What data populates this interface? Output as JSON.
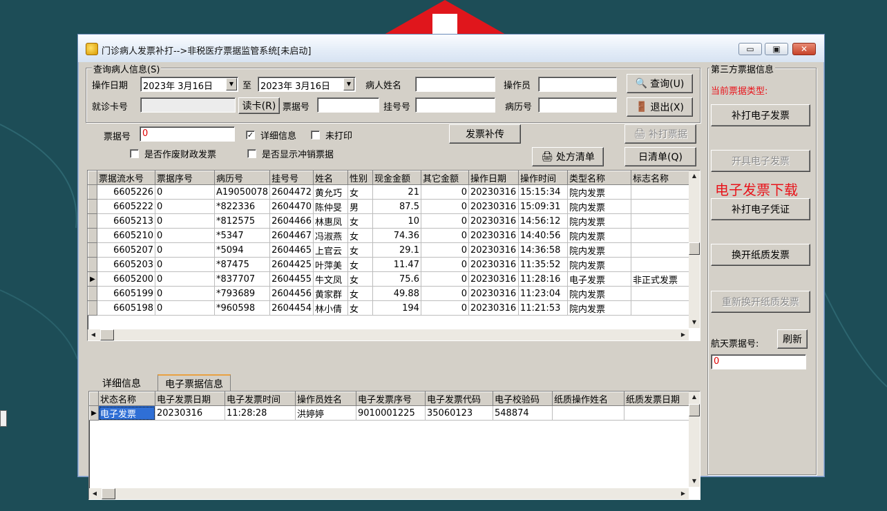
{
  "window": {
    "title": "门诊病人发票补打-->非税医疗票据监管系统[未启动]",
    "min_glyph": "▭",
    "max_glyph": "▣",
    "close_glyph": "✕"
  },
  "query": {
    "group_title": "查询病人信息(S)",
    "op_date_label": "操作日期",
    "date_from": "2023年 3月16日",
    "to_label": "至",
    "date_to": "2023年 3月16日",
    "patient_name_label": "病人姓名",
    "patient_name": "",
    "operator_label": "操作员",
    "operator": "",
    "search_button": "查询(U)",
    "card_label": "就诊卡号",
    "card_no": "",
    "read_card_button": "读卡(R)",
    "bill_label": "票据号",
    "bill_no": "",
    "reg_label": "挂号号",
    "reg_no": "",
    "record_label": "病历号",
    "record_no": "",
    "exit_button": "退出(X)"
  },
  "filters": {
    "bill_no_label": "票据号",
    "bill_no_value": "0",
    "detail_info": "详细信息",
    "detail_info_checked": true,
    "unprinted": "未打印",
    "unprinted_checked": false,
    "voided": "是否作废财政发票",
    "show_reversed": "是否显示冲销票据",
    "invoice_upload_button": "发票补传",
    "reprint_button": "补打票据",
    "prescription_button": "处方清单",
    "daily_button": "日清单(Q)"
  },
  "main_table": {
    "columns": [
      "票据流水号",
      "票据序号",
      "病历号",
      "挂号号",
      "姓名",
      "性别",
      "现金金额",
      "其它金额",
      "操作日期",
      "操作时间",
      "类型名称",
      "标志名称"
    ],
    "rows": [
      [
        "6605226",
        "0",
        "A19050078",
        "2604472",
        "黄允巧",
        "女",
        "21",
        "0",
        "20230316",
        "15:15:34",
        "院内发票",
        ""
      ],
      [
        "6605222",
        "0",
        "*822336",
        "2604470",
        "陈仲旻",
        "男",
        "87.5",
        "0",
        "20230316",
        "15:09:31",
        "院内发票",
        ""
      ],
      [
        "6605213",
        "0",
        "*812575",
        "2604466",
        "林惠凤",
        "女",
        "10",
        "0",
        "20230316",
        "14:56:12",
        "院内发票",
        ""
      ],
      [
        "6605210",
        "0",
        "*5347",
        "2604467",
        "冯淑燕",
        "女",
        "74.36",
        "0",
        "20230316",
        "14:40:56",
        "院内发票",
        ""
      ],
      [
        "6605207",
        "0",
        "*5094",
        "2604465",
        "上官云",
        "女",
        "29.1",
        "0",
        "20230316",
        "14:36:58",
        "院内发票",
        ""
      ],
      [
        "6605203",
        "0",
        "*87475",
        "2604425",
        "叶萍美",
        "女",
        "11.47",
        "0",
        "20230316",
        "11:35:52",
        "院内发票",
        ""
      ],
      [
        "6605200",
        "0",
        "*837707",
        "2604455",
        "牛文凤",
        "女",
        "75.6",
        "0",
        "20230316",
        "11:28:16",
        "电子发票",
        "非正式发票"
      ],
      [
        "6605199",
        "0",
        "*793689",
        "2604456",
        "黄家群",
        "女",
        "49.88",
        "0",
        "20230316",
        "11:23:04",
        "院内发票",
        ""
      ],
      [
        "6605198",
        "0",
        "*960598",
        "2604454",
        "林小倩",
        "女",
        "194",
        "0",
        "20230316",
        "11:21:53",
        "院内发票",
        ""
      ]
    ],
    "current_row_index": 6
  },
  "tabs": [
    {
      "label": "详细信息",
      "active": false
    },
    {
      "label": "电子票据信息",
      "active": true
    }
  ],
  "detail_table": {
    "columns": [
      "状态名称",
      "电子发票日期",
      "电子发票时间",
      "操作员姓名",
      "电子发票序号",
      "电子发票代码",
      "电子校验码",
      "纸质操作姓名",
      "纸质发票日期"
    ],
    "rows": [
      [
        "电子发票",
        "20230316",
        "11:28:28",
        "洪婷婷",
        "9010001225",
        "35060123",
        "548874",
        "",
        ""
      ]
    ]
  },
  "third_party": {
    "group_title": "第三方票据信息",
    "current_type_label": "当前票据类型:",
    "reprint_einvoice": "补打电子发票",
    "issue_einvoice": "开具电子发票",
    "einvoice_download": "电子发票下载",
    "reprint_evoucher": "补打电子凭证",
    "switch_paper": "换开纸质发票",
    "reswitch_paper": "重新换开纸质发票",
    "aerospace_label": "航天票据号:",
    "refresh_button": "刷新",
    "aerospace_value": "0"
  },
  "colors": {
    "desktop": "#1d4d57",
    "window_face": "#d4d0c8",
    "accent_red": "#e8141b",
    "selection": "#2f6fd6"
  }
}
